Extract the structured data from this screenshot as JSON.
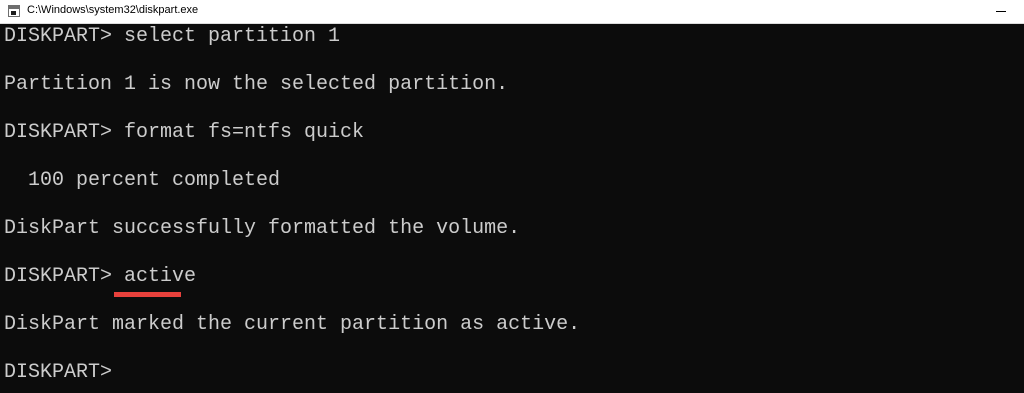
{
  "window": {
    "title": "C:\\Windows\\system32\\diskpart.exe",
    "icon": "console-app-icon"
  },
  "console": {
    "lines": [
      "DISKPART> select partition 1",
      "Partition 1 is now the selected partition.",
      "DISKPART> format fs=ntfs quick",
      "  100 percent completed",
      "DiskPart successfully formatted the volume.",
      "DISKPART> active",
      "DiskPart marked the current partition as active.",
      "DISKPART>"
    ],
    "text_color": "#cccccc",
    "background_color": "#0c0c0c",
    "highlight_color": "#e8413c"
  }
}
